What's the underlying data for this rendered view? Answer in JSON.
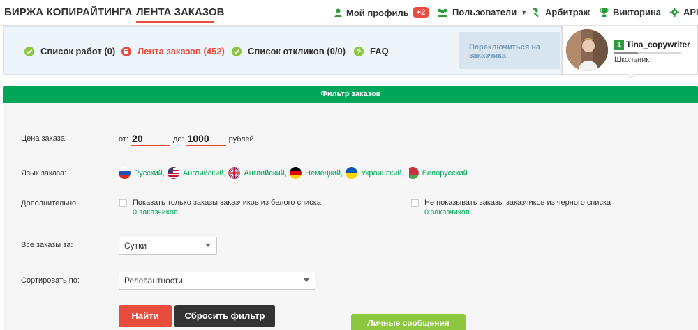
{
  "header": {
    "brand": "БИРЖА КОПИРАЙТИНГА",
    "separator": "›",
    "current": "ЛЕНТА ЗАКАЗОВ",
    "nav": {
      "profile": "Мой профиль",
      "profile_badge": "+2",
      "users": "Пользователи",
      "arbitration": "Арбитраж",
      "quiz": "Викторина",
      "api": "API"
    }
  },
  "subnav": {
    "items": [
      {
        "label": "Список работ (0)"
      },
      {
        "label": "Лента заказов (452)"
      },
      {
        "label": "Список откликов (0/0)"
      },
      {
        "label": "FAQ"
      }
    ],
    "switch_label": "Переключиться на заказчика"
  },
  "user": {
    "level": "1",
    "name": "Tina_copywriter",
    "rank": "Школьник",
    "progress": 0.35
  },
  "filter": {
    "title": "Фильтр заказов",
    "price": {
      "label": "Цена заказа:",
      "from_label": "от:",
      "from_value": "20",
      "to_label": "до:",
      "to_value": "1000",
      "unit": "рублей"
    },
    "language": {
      "label": "Язык заказа:",
      "items": [
        "Русский,",
        "Английский,",
        "Английский,",
        "Немецкий,",
        "Украинский,",
        "Белорусский"
      ]
    },
    "extra": {
      "label": "Дополнительно:",
      "whitelist": {
        "text": "Показать только заказы заказчиков из белого списка",
        "count": "0 заказчиков"
      },
      "blacklist": {
        "text": "Не показывать заказы заказчиков из черного списка",
        "count": "0 заказчиков"
      }
    },
    "period": {
      "label": "Все заказы за:",
      "value": "Сутки"
    },
    "sort": {
      "label": "Сортировать по:",
      "value": "Релевантности"
    },
    "find_button": "Найти",
    "reset_button": "Сбросить фильтр"
  },
  "messages_button": "Личные сообщения",
  "colors": {
    "accent_red": "#e84c3d",
    "green": "#00a65a",
    "light_green": "#8dc63f",
    "dark": "#333333"
  }
}
